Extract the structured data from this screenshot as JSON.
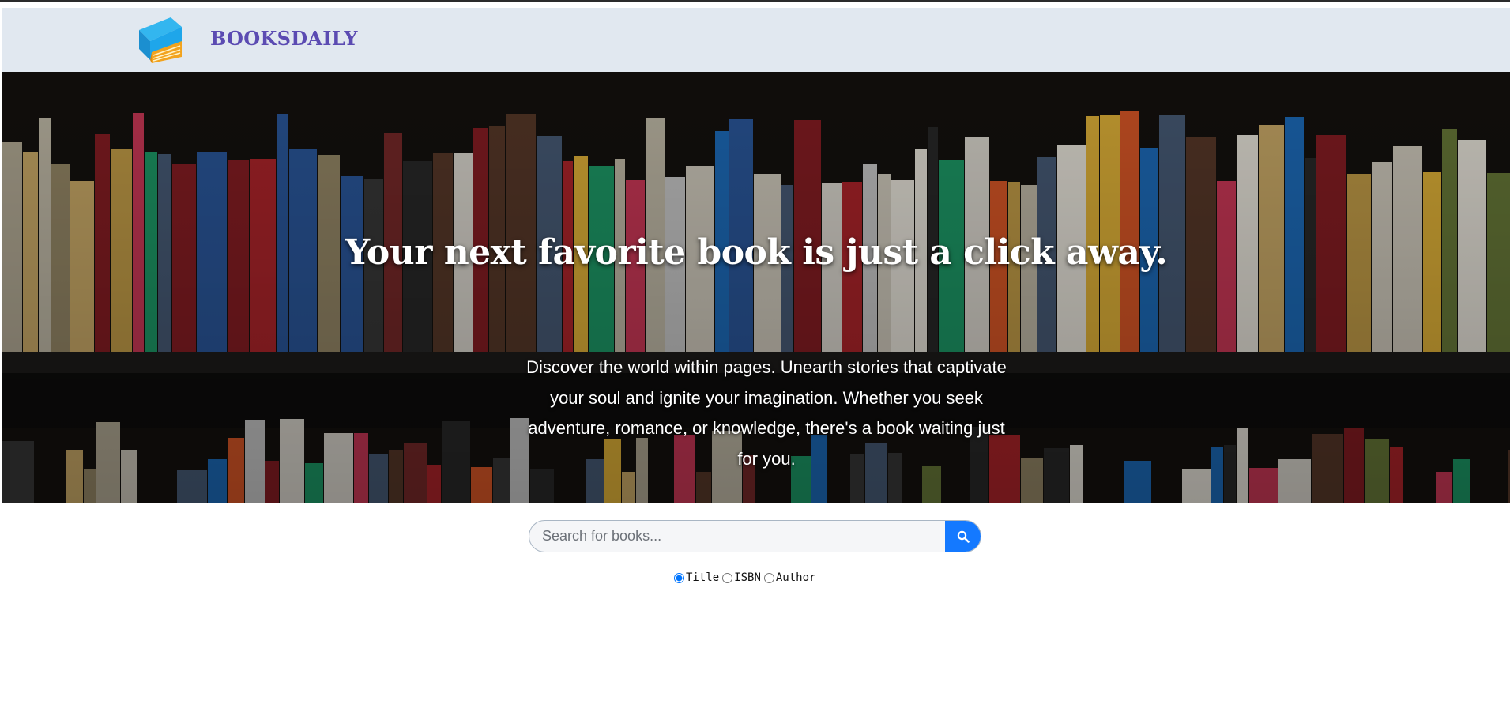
{
  "brand": {
    "name": "BOOKSDAILY",
    "logo_icon": "book-stack-icon"
  },
  "hero": {
    "title": "Your next favorite book is just a click away.",
    "subtitle": "Discover the world within pages. Unearth stories that captivate your soul and ignite your imagination. Whether you seek adventure, romance, or knowledge, there's a book waiting just for you.",
    "background": "bookshelf-photo"
  },
  "search": {
    "placeholder": "Search for books...",
    "value": "",
    "button_icon": "search-icon",
    "accent": "#1479ff"
  },
  "filters": {
    "selected": "Title",
    "options": [
      "Title",
      "ISBN",
      "Author"
    ]
  }
}
